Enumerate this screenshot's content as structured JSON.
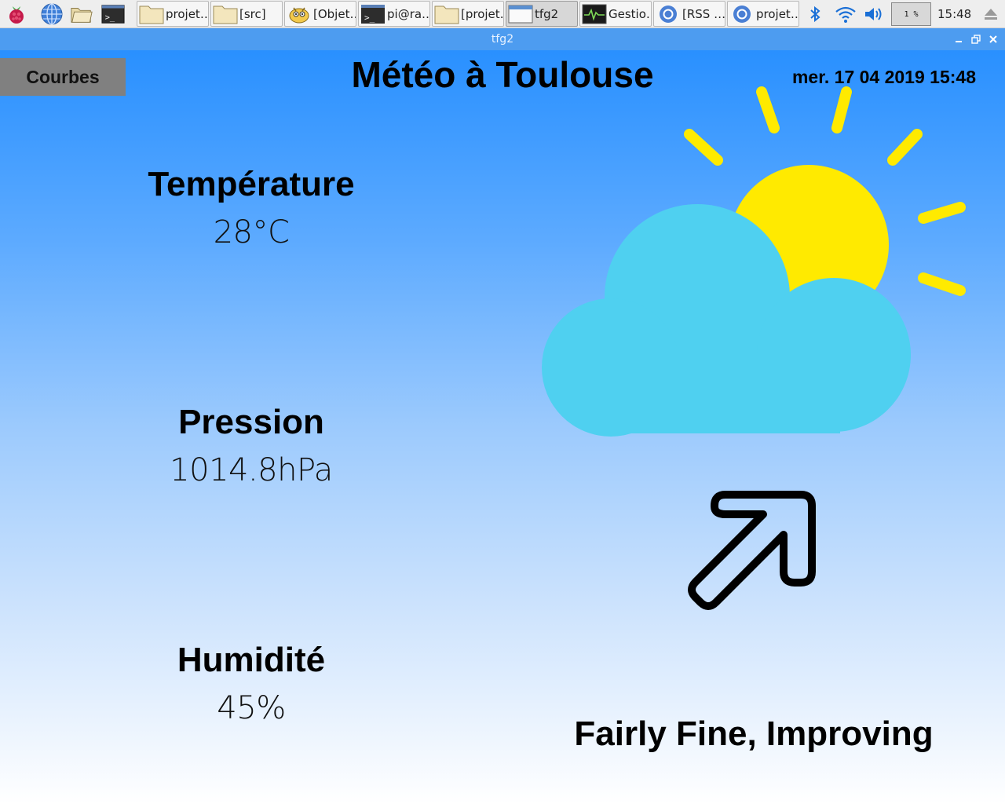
{
  "taskbar": {
    "launchers": [
      {
        "icon": "raspberry-menu-icon"
      },
      {
        "icon": "web-browser-icon"
      },
      {
        "icon": "file-manager-icon"
      },
      {
        "icon": "terminal-icon"
      }
    ],
    "tasks": [
      {
        "label": "projet…",
        "icon": "folder-icon",
        "active": false
      },
      {
        "label": "[src]",
        "icon": "folder-icon",
        "active": false
      },
      {
        "label": "[Objet…",
        "icon": "app-mascot-icon",
        "active": false
      },
      {
        "label": "pi@ra…",
        "icon": "terminal-icon",
        "active": false
      },
      {
        "label": "[projet…",
        "icon": "folder-icon",
        "active": false
      },
      {
        "label": "tfg2",
        "icon": "window-icon",
        "active": true
      },
      {
        "label": "Gestio…",
        "icon": "task-manager-icon",
        "active": false
      },
      {
        "label": "[RSS …",
        "icon": "chromium-icon",
        "active": false
      },
      {
        "label": "projet…",
        "icon": "chromium-icon",
        "active": false
      }
    ],
    "tray": {
      "cpu_usage": "1 %",
      "clock": "15:48",
      "icons": [
        "bluetooth-icon",
        "wifi-icon",
        "volume-icon",
        "eject-icon"
      ]
    }
  },
  "window": {
    "title": "tfg2",
    "controls": [
      "minimize-icon",
      "maximize-icon",
      "close-icon"
    ]
  },
  "app": {
    "courbes_button": "Courbes",
    "title": "Météo à Toulouse",
    "datetime": "mer. 17 04 2019 15:48",
    "metrics": [
      {
        "label": "Température",
        "value": "28°C"
      },
      {
        "label": "Pression",
        "value": "1014.8hPa"
      },
      {
        "label": "Humidité",
        "value": "45%"
      }
    ],
    "weather_icon": "partly-cloudy-icon",
    "trend_icon": "arrow-up-right-icon",
    "forecast": "Fairly Fine, Improving"
  },
  "colors": {
    "sky_top": "#2990ff",
    "sky_bottom": "#ffffff",
    "sun": "#ffea00",
    "cloud": "#4fd0f0",
    "titlebar": "#4d9cf0",
    "button_bg": "#808080"
  }
}
